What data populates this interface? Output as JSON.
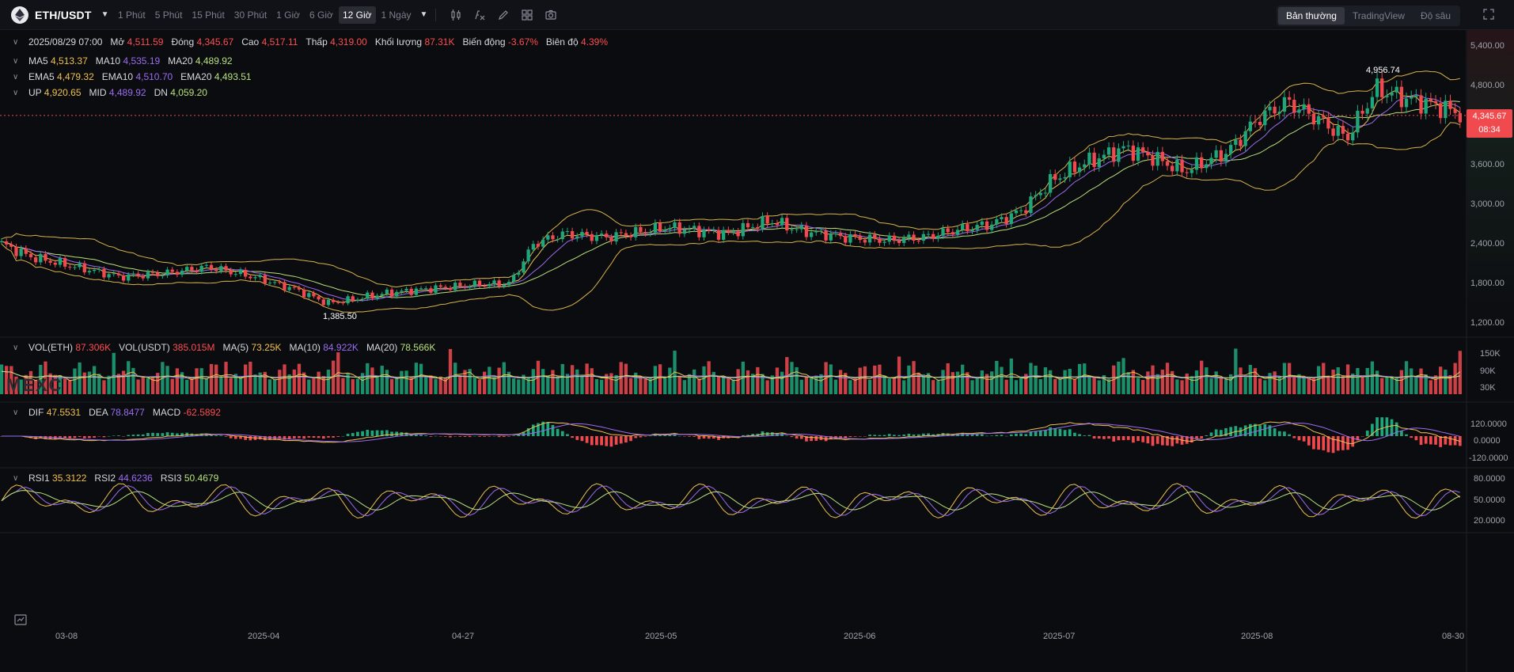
{
  "toolbar": {
    "symbol": "ETH/USDT",
    "intervals": [
      "1 Phút",
      "5 Phút",
      "15 Phút",
      "30 Phút",
      "1 Giờ",
      "6 Giờ",
      "12 Giờ",
      "1 Ngày"
    ],
    "active_interval": "12 Giờ",
    "views": [
      "Bản thường",
      "TradingView",
      "Độ sâu"
    ],
    "active_view": "Bản thường",
    "tools": [
      "candle-settings-icon",
      "indicator-icon",
      "draw-icon",
      "layout-icon",
      "camera-icon"
    ]
  },
  "ohlc": {
    "date": "2025/08/29 07:00",
    "open_label": "Mở",
    "open": "4,511.59",
    "close_label": "Đóng",
    "close": "4,345.67",
    "high_label": "Cao",
    "high": "4,517.11",
    "low_label": "Thấp",
    "low": "4,319.00",
    "vol_label": "Khối lượng",
    "vol": "87.31K",
    "change_label": "Biến động",
    "change": "-3.67%",
    "amp_label": "Biên độ",
    "amp": "4.39%"
  },
  "ma": {
    "ma5_label": "MA5",
    "ma5": "4,513.37",
    "ma10_label": "MA10",
    "ma10": "4,535.19",
    "ma20_label": "MA20",
    "ma20": "4,489.92"
  },
  "ema": {
    "ema5_label": "EMA5",
    "ema5": "4,479.32",
    "ema10_label": "EMA10",
    "ema10": "4,510.70",
    "ema20_label": "EMA20",
    "ema20": "4,493.51"
  },
  "boll": {
    "up_label": "UP",
    "up": "4,920.65",
    "mid_label": "MID",
    "mid": "4,489.92",
    "dn_label": "DN",
    "dn": "4,059.20"
  },
  "volume": {
    "eth_label": "VOL(ETH)",
    "eth": "87.306K",
    "usdt_label": "VOL(USDT)",
    "usdt": "385.015M",
    "ma5_label": "MA(5)",
    "ma5": "73.25K",
    "ma10_label": "MA(10)",
    "ma10": "84.922K",
    "ma20_label": "MA(20)",
    "ma20": "78.566K"
  },
  "macd": {
    "dif_label": "DIF",
    "dif": "47.5531",
    "dea_label": "DEA",
    "dea": "78.8477",
    "macd_label": "MACD",
    "macd": "-62.5892"
  },
  "rsi": {
    "rsi1_label": "RSI1",
    "rsi1": "35.3122",
    "rsi2_label": "RSI2",
    "rsi2": "44.6236",
    "rsi3_label": "RSI3",
    "rsi3": "50.4679"
  },
  "price_axis": [
    "5,400.00",
    "4,800.00",
    "3,600.00",
    "3,000.00",
    "2,400.00",
    "1,800.00",
    "1,200.00"
  ],
  "current_price": "4,345.67",
  "countdown": "08:34",
  "high_annotation": "4,956.74",
  "low_annotation": "1,385.50",
  "volume_axis": [
    "150K",
    "90K",
    "30K"
  ],
  "macd_axis": [
    "120.0000",
    "0.0000",
    "-120.0000"
  ],
  "rsi_axis": [
    "80.0000",
    "50.0000",
    "20.0000"
  ],
  "time_axis": [
    "03-08",
    "2025-04",
    "04-27",
    "2025-05",
    "2025-06",
    "2025-07",
    "2025-08",
    "08-30"
  ],
  "watermark": "MEXC",
  "colors": {
    "up": "#1fa67a",
    "down": "#f04a4f",
    "ma5": "#f0c04f",
    "ma10": "#9b6cf0",
    "ma20": "#b8e07a",
    "boll": "#d8b24a",
    "background": "#0b0c10"
  }
}
